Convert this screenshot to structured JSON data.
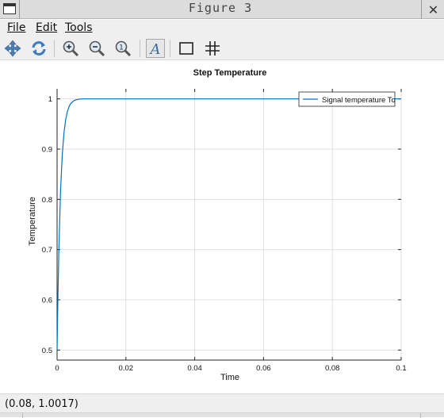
{
  "window": {
    "title": "Figure 3"
  },
  "menu": {
    "file": "File",
    "edit": "Edit",
    "tools": "Tools"
  },
  "toolbar": {
    "tools": [
      "pan-icon",
      "rotate-icon",
      "zoom-in-icon",
      "zoom-out-icon",
      "zoom-reset-icon",
      "text-insert-icon",
      "box-axes-icon",
      "grid-toggle-icon"
    ],
    "text_tool_glyph": "A"
  },
  "colors": {
    "line": "#0072bd",
    "grid": "#e0e0e0",
    "axis": "#262626"
  },
  "status": {
    "coordinates": "(0.08, 1.0017)"
  },
  "chart_data": {
    "type": "line",
    "title": "Step Temperature",
    "xlabel": "Time",
    "ylabel": "Temperature",
    "xlim": [
      0,
      0.1
    ],
    "ylim": [
      0.48,
      1.02
    ],
    "xticks": [
      0,
      0.02,
      0.04,
      0.06,
      0.08,
      0.1
    ],
    "xtick_labels": [
      "0",
      "0.02",
      "0.04",
      "0.06",
      "0.08",
      "0.1"
    ],
    "yticks": [
      0.5,
      0.6,
      0.7,
      0.8,
      0.9,
      1
    ],
    "ytick_labels": [
      "0.5",
      "0.6",
      "0.7",
      "0.8",
      "0.9",
      "1"
    ],
    "grid": true,
    "legend_position": "top-right",
    "series": [
      {
        "name": "Signal temperature To",
        "color": "#0072bd",
        "x": [
          0,
          0.0002,
          0.0005,
          0.001,
          0.0015,
          0.002,
          0.0025,
          0.003,
          0.0035,
          0.004,
          0.005,
          0.006,
          0.007,
          0.008,
          0.009,
          0.01,
          0.02,
          0.04,
          0.06,
          0.08,
          0.1
        ],
        "y": [
          0.5,
          0.59,
          0.695,
          0.816,
          0.888,
          0.932,
          0.959,
          0.975,
          0.985,
          0.991,
          0.997,
          0.999,
          1.0,
          1.0,
          1.0,
          1.0,
          1.0,
          1.0,
          1.0,
          1.0,
          1.0
        ]
      }
    ]
  }
}
